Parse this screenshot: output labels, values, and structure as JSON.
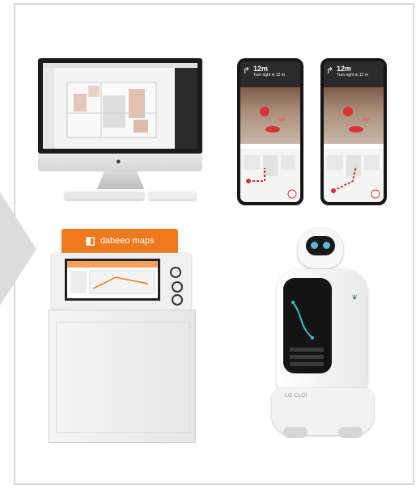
{
  "kiosk": {
    "brand": "dabeeo maps"
  },
  "phone": {
    "distance": "12m",
    "instruction": "Turn right in 12 m"
  },
  "robot": {
    "base_label": "LG CLOi"
  },
  "colors": {
    "orange": "#ef7a1e",
    "frame": "#d9d9d9",
    "arrow": "#dcdcdc",
    "red": "#d8333a",
    "eye": "#59b7e0"
  },
  "icons": {
    "apple": "apple-icon",
    "turn": "turn-right-arrow-icon",
    "brand": "dabeeo-logo-icon"
  }
}
